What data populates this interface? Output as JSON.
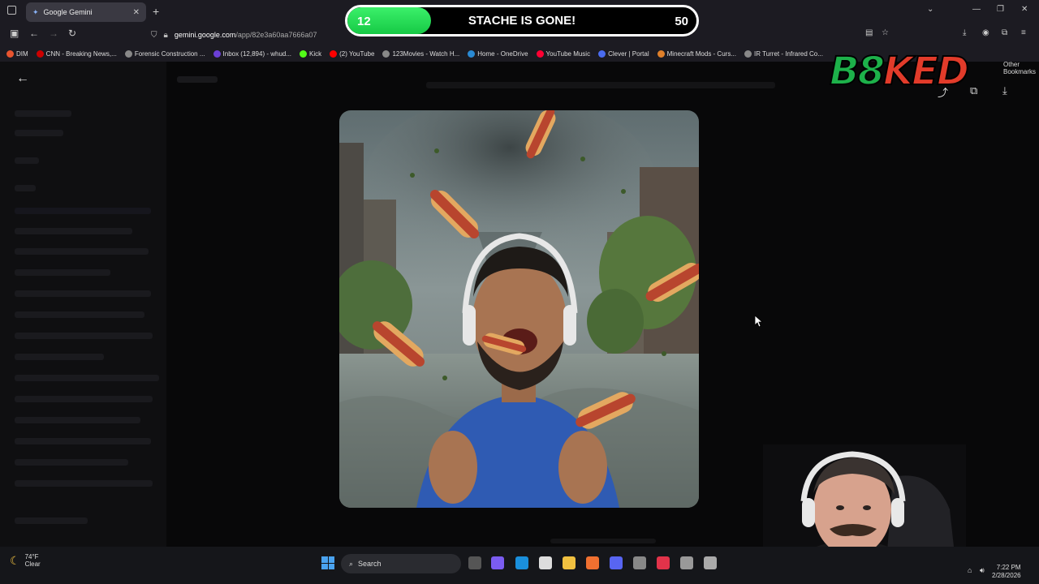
{
  "browser": {
    "tab_title": "Google Gemini",
    "url_domain": "gemini.google.com",
    "url_path": "/app/82e3a60aa7666a07",
    "other_bookmarks": "Other Bookmarks"
  },
  "bookmarks": [
    {
      "label": "DIM",
      "color": "#e8542f"
    },
    {
      "label": "CNN - Breaking News,...",
      "color": "#cc0000"
    },
    {
      "label": "Forensic Construction ...",
      "color": "#888888"
    },
    {
      "label": "Inbox (12,894) - whud...",
      "color": "#6b3fd6"
    },
    {
      "label": "Kick",
      "color": "#53fc18"
    },
    {
      "label": "(2) YouTube",
      "color": "#ff0000"
    },
    {
      "label": "123Movies - Watch H...",
      "color": "#888888"
    },
    {
      "label": "Home - OneDrive",
      "color": "#2a8ad4"
    },
    {
      "label": "YouTube Music",
      "color": "#ff0033"
    },
    {
      "label": "Clever | Portal",
      "color": "#4a6cf0"
    },
    {
      "label": "Minecraft Mods - Curs...",
      "color": "#e0802a"
    },
    {
      "label": "IR Turret - Infrared Co...",
      "color": "#888888"
    }
  ],
  "overlay": {
    "progress_current": "12",
    "progress_title": "STACHE IS GONE!",
    "progress_goal": "50",
    "progress_fraction": 0.24,
    "brand_part1": "B8",
    "brand_part2": "KED"
  },
  "taskbar": {
    "temperature": "74°F",
    "condition": "Clear",
    "search_placeholder": "Search",
    "time": "7:22 PM",
    "date": "2/28/2026"
  }
}
